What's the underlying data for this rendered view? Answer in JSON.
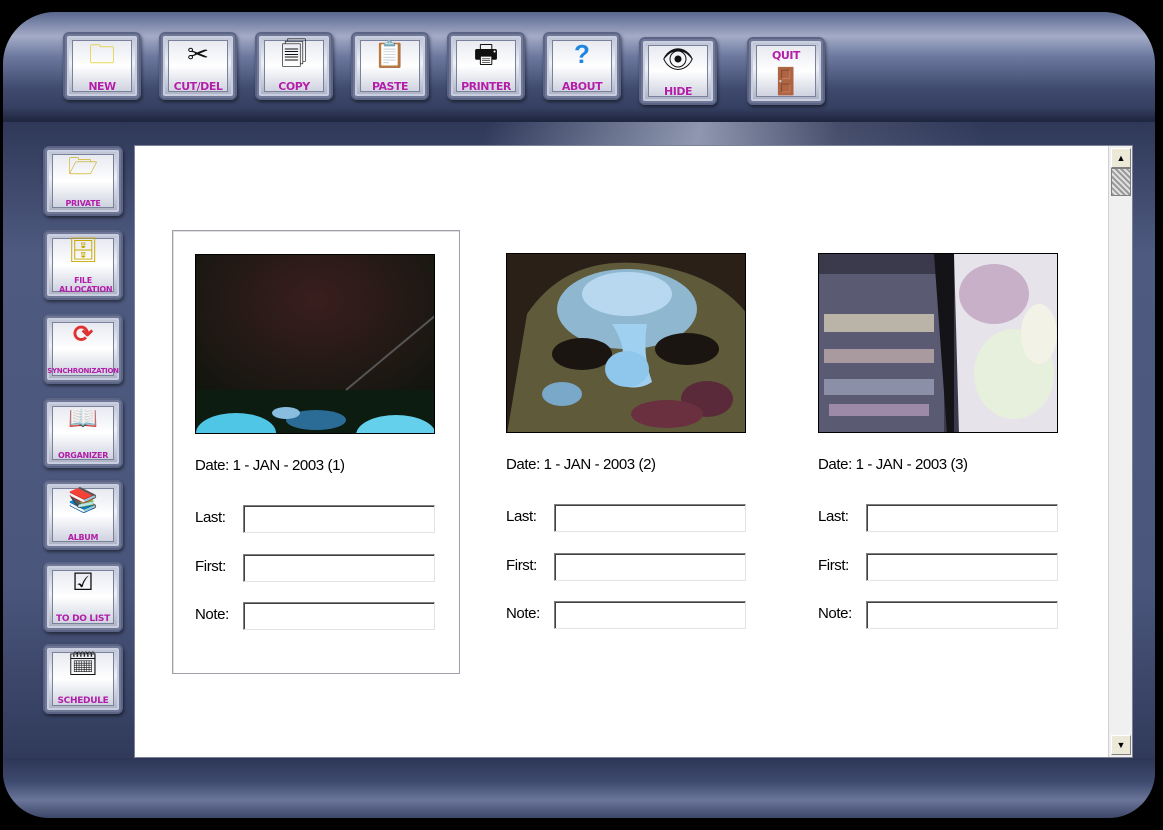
{
  "toolbar": {
    "buttons": [
      {
        "label": "NEW",
        "icon": "folder-icon",
        "glyph": "🗀"
      },
      {
        "label": "CUT/DEL",
        "icon": "scissors-icon",
        "glyph": "✂"
      },
      {
        "label": "COPY",
        "icon": "document-icon",
        "glyph": "🗐"
      },
      {
        "label": "PASTE",
        "icon": "clipboard-icon",
        "glyph": "📋"
      },
      {
        "label": "PRINTER",
        "icon": "printer-icon",
        "glyph": "🖶"
      },
      {
        "label": "ABOUT",
        "icon": "question-icon",
        "glyph": "?"
      },
      {
        "label": "HIDE",
        "icon": "eye-icon",
        "glyph": "👁"
      },
      {
        "label": "QUIT",
        "icon": "exit-door-icon",
        "glyph": "🚪"
      }
    ]
  },
  "sidebar": {
    "buttons": [
      {
        "label": "PRIVATE",
        "icon": "private-folder-icon",
        "glyph": "🗁"
      },
      {
        "label": "FILE ALLOCATION",
        "icon": "file-cabinet-icon",
        "glyph": "🗄"
      },
      {
        "label": "SYNCHRONIZATION",
        "icon": "sync-arrows-icon",
        "glyph": "⟳"
      },
      {
        "label": "ORGANIZER",
        "icon": "book-icon",
        "glyph": "📖"
      },
      {
        "label": "ALBUM",
        "icon": "album-stack-icon",
        "glyph": "📚"
      },
      {
        "label": "TO DO LIST",
        "icon": "checklist-icon",
        "glyph": "☑"
      },
      {
        "label": "SCHEDULE",
        "icon": "schedule-icon",
        "glyph": "🗓"
      }
    ]
  },
  "cards": [
    {
      "date": "Date: 1 - JAN - 2003 (1)",
      "last_label": "Last:",
      "first_label": "First:",
      "note_label": "Note:",
      "last": "",
      "first": "",
      "note": ""
    },
    {
      "date": "Date: 1 - JAN - 2003 (2)",
      "last_label": "Last:",
      "first_label": "First:",
      "note_label": "Note:",
      "last": "",
      "first": "",
      "note": ""
    },
    {
      "date": "Date: 1 - JAN - 2003 (3)",
      "last_label": "Last:",
      "first_label": "First:",
      "note_label": "Note:",
      "last": "",
      "first": "",
      "note": ""
    }
  ],
  "scrollbar": {
    "up_glyph": "▲",
    "down_glyph": "▼"
  },
  "colors": {
    "label_accent": "#b21ea8",
    "frame": "#3b4667"
  }
}
